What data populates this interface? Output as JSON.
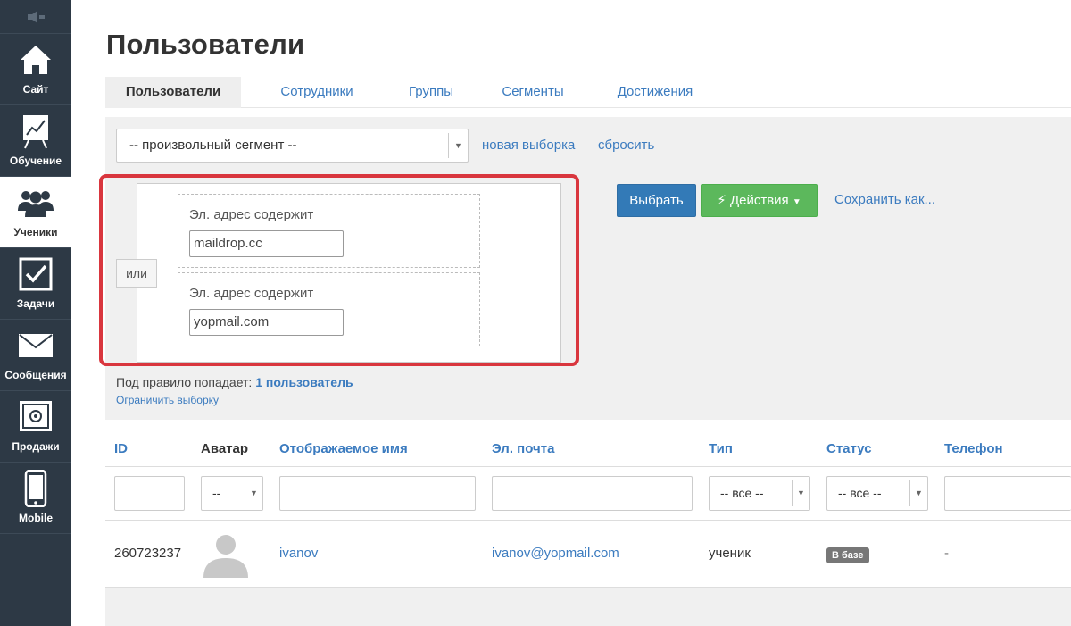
{
  "sidebar": {
    "items": [
      {
        "label": "Сайт",
        "icon": "home-icon"
      },
      {
        "label": "Обучение",
        "icon": "chart-board-icon"
      },
      {
        "label": "Ученики",
        "icon": "users-icon"
      },
      {
        "label": "Задачи",
        "icon": "checkbox-icon"
      },
      {
        "label": "Сообщения",
        "icon": "envelope-icon"
      },
      {
        "label": "Продажи",
        "icon": "safe-icon"
      },
      {
        "label": "Mobile",
        "icon": "phone-icon"
      }
    ]
  },
  "page": {
    "title": "Пользователи"
  },
  "tabs": [
    {
      "label": "Пользователи"
    },
    {
      "label": "Сотрудники"
    },
    {
      "label": "Группы"
    },
    {
      "label": "Сегменты"
    },
    {
      "label": "Достижения"
    }
  ],
  "filter": {
    "segment_value": "-- произвольный сегмент --",
    "new_selection": "новая выборка",
    "reset": "сбросить",
    "or_label": "или",
    "conditions": [
      {
        "label": "Эл. адрес содержит",
        "value": "maildrop.cc"
      },
      {
        "label": "Эл. адрес содержит",
        "value": "yopmail.com"
      }
    ],
    "select_button": "Выбрать",
    "actions_button": "Действия",
    "save_as": "Сохранить как...",
    "count_prefix": "Под правило попадает:",
    "count_value": "1 пользователь",
    "limit_link": "Ограничить выборку"
  },
  "table": {
    "columns": [
      "ID",
      "Аватар",
      "Отображаемое имя",
      "Эл. почта",
      "Тип",
      "Статус",
      "Телефон"
    ],
    "filters": {
      "avatar": "--",
      "type": "-- все --",
      "status": "-- все --"
    },
    "rows": [
      {
        "id": "260723237",
        "name": "ivanov",
        "email": "ivanov@yopmail.com",
        "type": "ученик",
        "status": "В базе",
        "phone": "-"
      }
    ]
  },
  "colors": {
    "accent": "#3b7bbf",
    "sidebar": "#2d3945",
    "primary_button": "#337ab7",
    "success_button": "#5cb85c",
    "highlight": "#d9363e"
  }
}
